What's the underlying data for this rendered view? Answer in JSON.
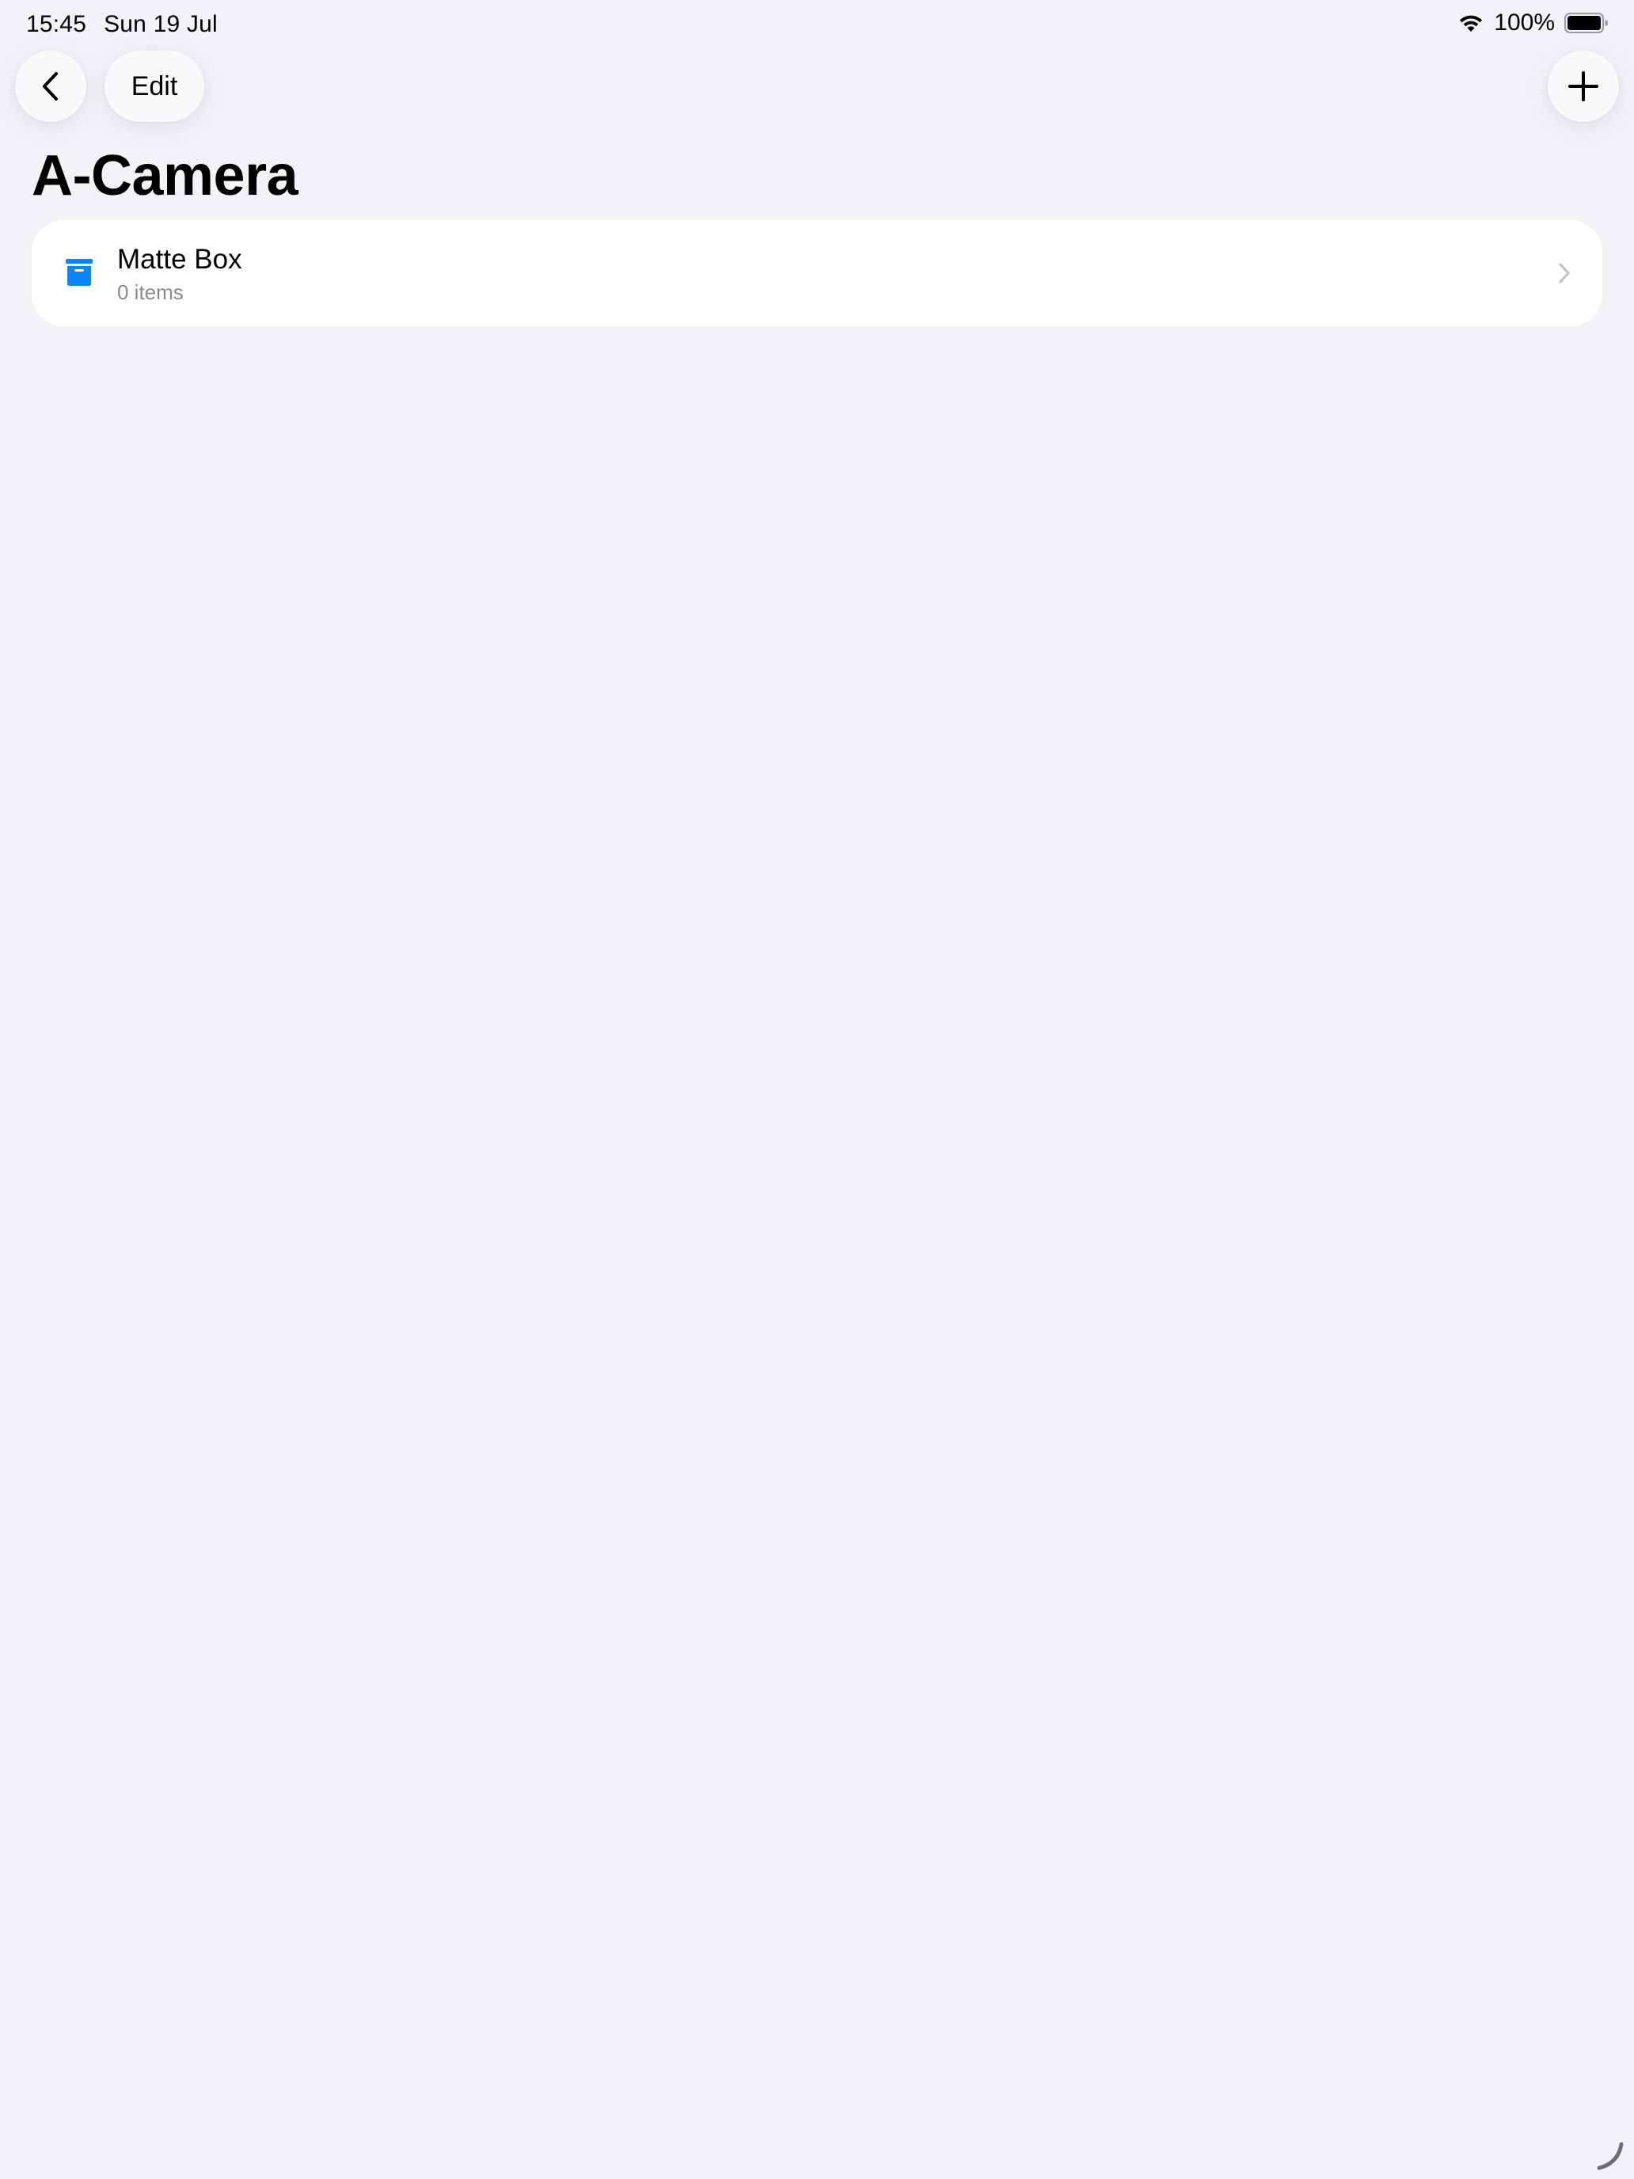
{
  "status_bar": {
    "time": "15:45",
    "date": "Sun 19 Jul",
    "battery": "100%"
  },
  "toolbar": {
    "edit_label": "Edit"
  },
  "page": {
    "title": "A-Camera"
  },
  "items": [
    {
      "title": "Matte Box",
      "subtitle": "0 items",
      "icon": "archive-box-icon"
    }
  ],
  "colors": {
    "background": "#f2f2f7",
    "accent": "#0a84ff",
    "secondary_text": "#8a8a8e",
    "chevron": "#c4c4c6"
  }
}
